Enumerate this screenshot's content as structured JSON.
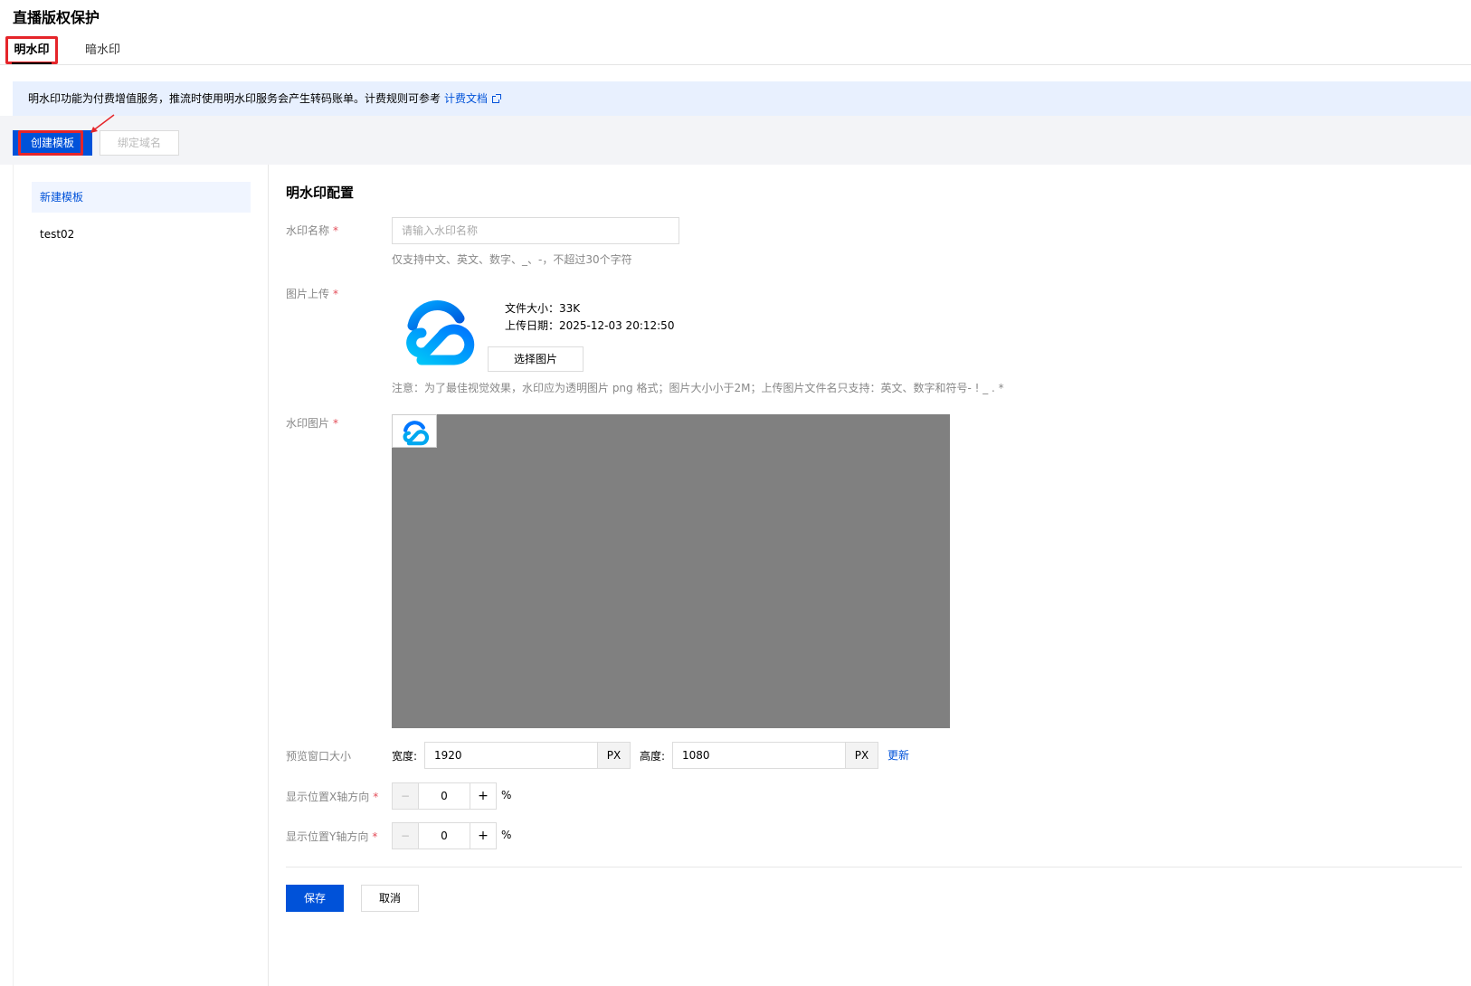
{
  "page": {
    "title": "直播版权保护"
  },
  "tabs": [
    {
      "label": "明水印"
    },
    {
      "label": "暗水印"
    }
  ],
  "notice": {
    "text": "明水印功能为付费增值服务，推流时使用明水印服务会产生转码账单。计费规则可参考",
    "link": "计费文档"
  },
  "toolbar": {
    "create": "创建模板",
    "bind": "绑定域名"
  },
  "sidebar": {
    "items": [
      {
        "label": "新建模板"
      },
      {
        "label": "test02"
      }
    ]
  },
  "form": {
    "title": "明水印配置",
    "name_label": "水印名称",
    "name_placeholder": "请输入水印名称",
    "name_hint": "仅支持中文、英文、数字、_、-，不超过30个字符",
    "upload_label": "图片上传",
    "file_size": "文件大小：33K",
    "upload_date": "上传日期：2025-12-03 20:12:50",
    "choose_button": "选择图片",
    "upload_hint": "注意：为了最佳视觉效果，水印应为透明图片 png 格式；图片大小小于2M；上传图片文件名只支持：英文、数字和符号- ! _ . *",
    "watermark_label": "水印图片",
    "preview_size_label": "预览窗口大小",
    "width_label": "宽度:",
    "width_value": "1920",
    "height_label": "高度:",
    "height_value": "1080",
    "unit": "PX",
    "update_link": "更新",
    "x_label": "显示位置X轴方向",
    "x_value": "0",
    "y_label": "显示位置Y轴方向",
    "y_value": "0",
    "percent": "%",
    "required_mark": "*",
    "minus": "−",
    "plus": "+",
    "save": "保存",
    "cancel": "取消"
  },
  "colors": {
    "primary": "#0052d9",
    "highlight": "#e5252a",
    "notice_bg": "#e8f0fe",
    "preview_bg": "#808080"
  },
  "icons": {
    "logo": "tencent-cloud-icon",
    "external": "external-link-icon"
  }
}
